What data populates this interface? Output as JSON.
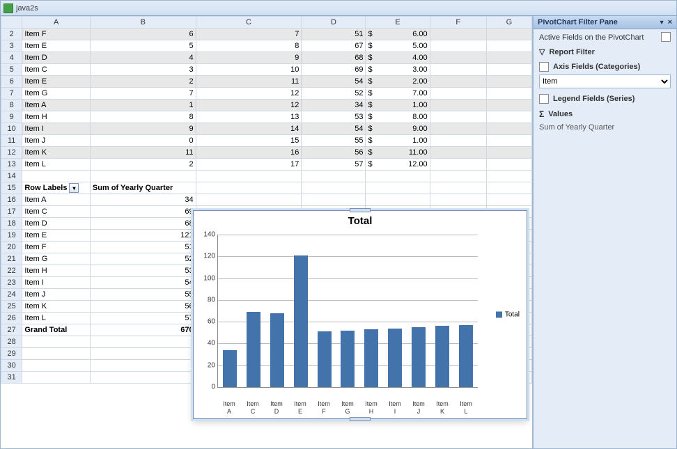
{
  "window": {
    "title": "java2s"
  },
  "columns": [
    "A",
    "B",
    "C",
    "D",
    "E",
    "F",
    "G"
  ],
  "data_rows": [
    {
      "r": 2,
      "a": "Item F",
      "b": 6,
      "c": 7,
      "d": 51,
      "e": "6.00",
      "h": true
    },
    {
      "r": 3,
      "a": "Item E",
      "b": 5,
      "c": 8,
      "d": 67,
      "e": "5.00",
      "h": false
    },
    {
      "r": 4,
      "a": "Item D",
      "b": 4,
      "c": 9,
      "d": 68,
      "e": "4.00",
      "h": true
    },
    {
      "r": 5,
      "a": "Item C",
      "b": 3,
      "c": 10,
      "d": 69,
      "e": "3.00",
      "h": false
    },
    {
      "r": 6,
      "a": "Item E",
      "b": 2,
      "c": 11,
      "d": 54,
      "e": "2.00",
      "h": true
    },
    {
      "r": 7,
      "a": "Item G",
      "b": 7,
      "c": 12,
      "d": 52,
      "e": "7.00",
      "h": false
    },
    {
      "r": 8,
      "a": "Item A",
      "b": 1,
      "c": 12,
      "d": 34,
      "e": "1.00",
      "h": true
    },
    {
      "r": 9,
      "a": "Item H",
      "b": 8,
      "c": 13,
      "d": 53,
      "e": "8.00",
      "h": false
    },
    {
      "r": 10,
      "a": "Item I",
      "b": 9,
      "c": 14,
      "d": 54,
      "e": "9.00",
      "h": true
    },
    {
      "r": 11,
      "a": "Item J",
      "b": 0,
      "c": 15,
      "d": 55,
      "e": "1.00",
      "h": false
    },
    {
      "r": 12,
      "a": "Item K",
      "b": 11,
      "c": 16,
      "d": 56,
      "e": "11.00",
      "h": true
    },
    {
      "r": 13,
      "a": "Item L",
      "b": 2,
      "c": 17,
      "d": 57,
      "e": "12.00",
      "h": false
    }
  ],
  "pivot": {
    "header_row": 15,
    "row_labels_label": "Row Labels",
    "sum_label": "Sum of Yearly Quarter",
    "rows": [
      {
        "r": 16,
        "item": "Item A",
        "val": 34
      },
      {
        "r": 17,
        "item": "Item C",
        "val": 69
      },
      {
        "r": 18,
        "item": "Item D",
        "val": 68
      },
      {
        "r": 19,
        "item": "Item E",
        "val": 121
      },
      {
        "r": 20,
        "item": "Item F",
        "val": 51
      },
      {
        "r": 21,
        "item": "Item G",
        "val": 52
      },
      {
        "r": 22,
        "item": "Item H",
        "val": 53
      },
      {
        "r": 23,
        "item": "Item I",
        "val": 54
      },
      {
        "r": 24,
        "item": "Item J",
        "val": 55
      },
      {
        "r": 25,
        "item": "Item K",
        "val": 56
      },
      {
        "r": 26,
        "item": "Item L",
        "val": 57
      }
    ],
    "grand_row": 27,
    "grand_label": "Grand Total",
    "grand_val": 670
  },
  "blank_rows": [
    14,
    28,
    29,
    30,
    31
  ],
  "pane": {
    "title": "PivotChart Filter Pane",
    "active_fields": "Active Fields on the PivotChart",
    "report_filter": "Report Filter",
    "axis_fields": "Axis Fields (Categories)",
    "axis_value": "Item",
    "legend_fields": "Legend Fields (Series)",
    "values_label": "Values",
    "values_sum": "Sum of Yearly Quarter"
  },
  "chart_data": {
    "type": "bar",
    "title": "Total",
    "categories": [
      "Item A",
      "Item C",
      "Item D",
      "Item E",
      "Item F",
      "Item G",
      "Item H",
      "Item I",
      "Item J",
      "Item K",
      "Item L"
    ],
    "xtick_lines": [
      [
        "Item",
        "A"
      ],
      [
        "Item",
        "C"
      ],
      [
        "Item",
        "D"
      ],
      [
        "Item",
        "E"
      ],
      [
        "Item",
        "F"
      ],
      [
        "Item",
        "G"
      ],
      [
        "Item",
        "H"
      ],
      [
        "Item",
        "I"
      ],
      [
        "Item",
        "J"
      ],
      [
        "Item",
        "K"
      ],
      [
        "Item",
        "L"
      ]
    ],
    "values": [
      34,
      69,
      68,
      121,
      51,
      52,
      53,
      54,
      55,
      56,
      57
    ],
    "series_name": "Total",
    "ylim": [
      0,
      140
    ],
    "yticks": [
      0,
      20,
      40,
      60,
      80,
      100,
      120,
      140
    ]
  }
}
